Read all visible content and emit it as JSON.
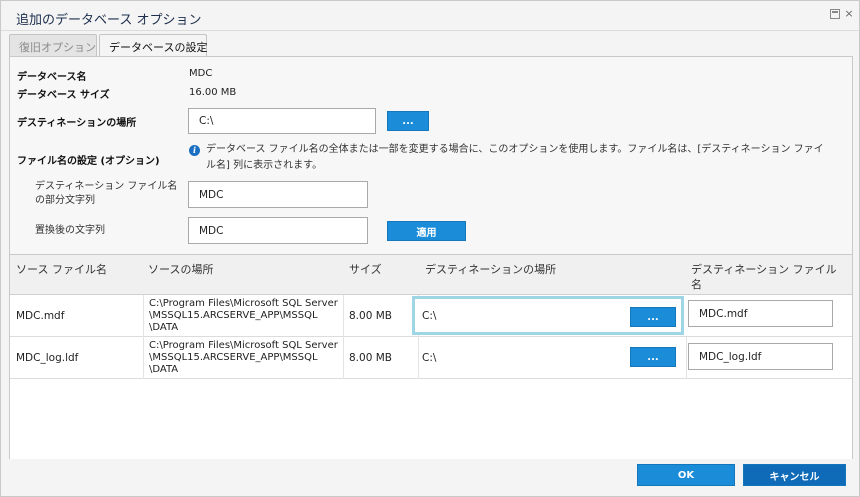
{
  "window": {
    "title": "追加のデータベース オプション",
    "restore_icon": "restore-icon",
    "close_icon": "close-icon",
    "close_glyph": "×"
  },
  "tabs": [
    {
      "label": "復旧オプション",
      "active": false
    },
    {
      "label": "データベースの設定",
      "active": true
    }
  ],
  "settings": {
    "db_name_label": "データベース名",
    "db_name_value": "MDC",
    "db_size_label": "データベース サイズ",
    "db_size_value": "16.00 MB",
    "dest_label": "デスティネーションの場所",
    "dest_value": "C:\\",
    "browse_label": "...",
    "filename_label": "ファイル名の設定 (オプション)",
    "info_text": "データベース ファイル名の全体または一部を変更する場合に、このオプションを使用します。ファイル名は、[デスティネーション ファイル名] 列に表示されます。",
    "partial_label": "デスティネーション ファイル名の部分文字列",
    "partial_value": "MDC",
    "replace_label": "置換後の文字列",
    "replace_value": "MDC",
    "apply_label": "適用"
  },
  "table": {
    "headers": [
      "ソース ファイル名",
      "ソースの場所",
      "サイズ",
      "デスティネーションの場所",
      "デスティネーション ファイル名"
    ],
    "rows": [
      {
        "source_file": "MDC.mdf",
        "source_location": "C:\\Program Files\\Microsoft SQL Server \\MSSQL15.ARCSERVE_APP\\MSSQL \\DATA",
        "size": "8.00 MB",
        "dest_location": "C:\\",
        "browse_label": "...",
        "dest_file": "MDC.mdf"
      },
      {
        "source_file": "MDC_log.ldf",
        "source_location": "C:\\Program Files\\Microsoft SQL Server \\MSSQL15.ARCSERVE_APP\\MSSQL \\DATA",
        "size": "8.00 MB",
        "dest_location": "C:\\",
        "browse_label": "...",
        "dest_file": "MDC_log.ldf"
      }
    ]
  },
  "footer": {
    "ok_label": "OK",
    "cancel_label": "キャンセル"
  },
  "colors": {
    "primary_button": "#1a8cd8",
    "cancel_button": "#0f6bb8",
    "focus_highlight": "#9fd6e6"
  }
}
